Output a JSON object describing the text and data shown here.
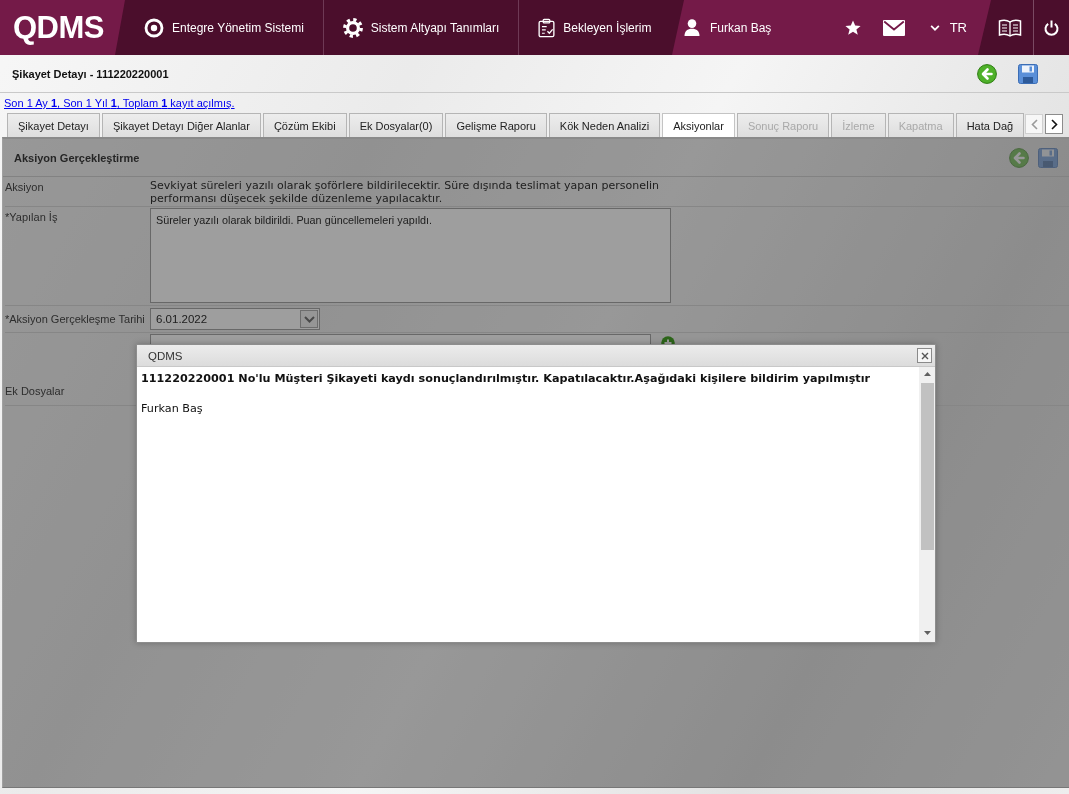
{
  "header": {
    "logo": "QDMS",
    "nav": [
      {
        "kind": "ring",
        "label": "Entegre Yönetim Sistemi"
      },
      {
        "kind": "gear",
        "label": "Sistem Altyapı Tanımları"
      },
      {
        "kind": "clipboard",
        "label": "Bekleyen İşlerim"
      }
    ],
    "user": "Furkan Baş",
    "language": "TR"
  },
  "page": {
    "title": "Şikayet Detayı - 111220220001",
    "record_summary": "Son 1 Ay **1**, Son 1 Yıl **1**, Toplam **1** kayıt açılmış."
  },
  "tabs": [
    {
      "label": "Şikayet Detayı",
      "selected": false,
      "disabled": false
    },
    {
      "label": "Şikayet Detayı Diğer Alanlar",
      "selected": false,
      "disabled": false
    },
    {
      "label": "Çözüm Ekibi",
      "selected": false,
      "disabled": false
    },
    {
      "label": "Ek Dosyalar(0)",
      "selected": false,
      "disabled": false
    },
    {
      "label": "Gelişme Raporu",
      "selected": false,
      "disabled": false
    },
    {
      "label": "Kök Neden Analizi",
      "selected": false,
      "disabled": false
    },
    {
      "label": "Aksiyonlar",
      "selected": true,
      "disabled": false
    },
    {
      "label": "Sonuç Raporu",
      "selected": false,
      "disabled": true
    },
    {
      "label": "İzleme",
      "selected": false,
      "disabled": true
    },
    {
      "label": "Kapatma",
      "selected": false,
      "disabled": true
    },
    {
      "label": "Hata Dağ",
      "selected": false,
      "disabled": false
    }
  ],
  "tab_scroll": [
    {
      "kind": "prev",
      "disabled": true
    },
    {
      "kind": "next",
      "disabled": false
    }
  ],
  "panel": {
    "title": "Aksiyon Gerçekleştirme",
    "fields": [
      {
        "kind": "text",
        "label": "Aksiyon",
        "value": "Sevkiyat süreleri yazılı olarak şoförlere bildirilecektir. Süre dışında teslimat yapan personelin performansı düşecek şekilde düzenleme yapılacaktır."
      },
      {
        "kind": "textarea",
        "label": "*Yapılan İş",
        "value": "Süreler yazılı olarak bildirildi. Puan güncellemeleri yapıldı."
      },
      {
        "kind": "date",
        "label": "*Aksiyon Gerçekleşme Tarihi",
        "value": "6.01.2022"
      },
      {
        "kind": "lookup"
      },
      {
        "kind": "files",
        "label": "Ek Dosyalar"
      }
    ]
  },
  "dialog": {
    "title": "QDMS",
    "message": "111220220001 No'lu Müşteri Şikayeti kaydı sonuçlandırılmıştır. Kapatılacaktır.Aşağıdaki kişilere bildirim yapılmıştır",
    "recipients": [
      "Furkan Baş"
    ]
  }
}
